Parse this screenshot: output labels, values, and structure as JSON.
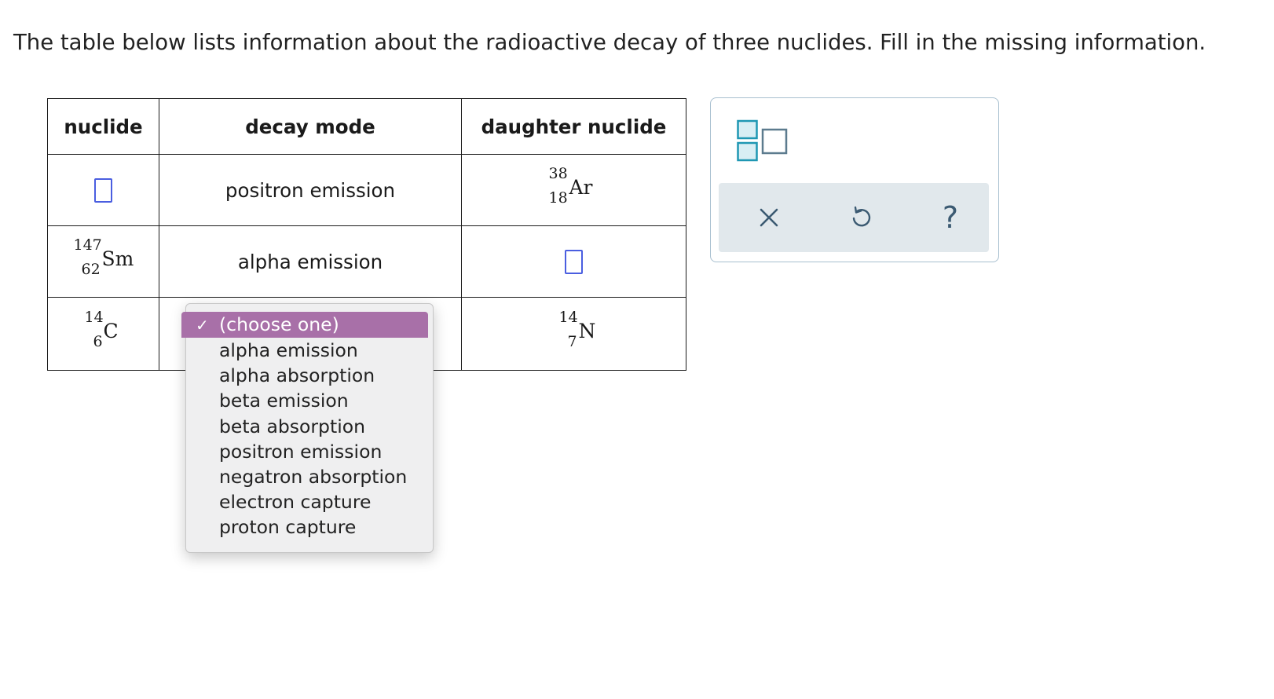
{
  "instruction": "The table below lists information about the radioactive decay of three nuclides. Fill in the missing information.",
  "table": {
    "headers": [
      "nuclide",
      "decay mode",
      "daughter nuclide"
    ],
    "rows": [
      {
        "nuclide": null,
        "decay_mode": "positron emission",
        "daughter": {
          "mass": "38",
          "atomic": "18",
          "symbol": "Ar"
        }
      },
      {
        "nuclide": {
          "mass": "147",
          "atomic": "62",
          "symbol": "Sm"
        },
        "decay_mode": "alpha emission",
        "daughter": null
      },
      {
        "nuclide": {
          "mass": "14",
          "atomic": "6",
          "symbol": "C"
        },
        "decay_mode": null,
        "daughter": {
          "mass": "14",
          "atomic": "7",
          "symbol": "N"
        }
      }
    ]
  },
  "dropdown": {
    "selected_check": "✓",
    "selected_label": "(choose one)",
    "options": [
      "alpha emission",
      "alpha absorption",
      "beta emission",
      "beta absorption",
      "positron emission",
      "negatron absorption",
      "electron capture",
      "proton capture"
    ]
  },
  "toolbar": {
    "icons": [
      "superscript-subscript-template-icon",
      "close-icon",
      "undo-icon",
      "help-icon"
    ],
    "help_label": "?"
  },
  "colors": {
    "answer_box_border": "#4a5ee0",
    "dropdown_highlight": "#a870a8",
    "toolbar_bg": "#e1e8ec",
    "panel_border": "#a7bfcf",
    "template_icon": "#1f97b3"
  }
}
